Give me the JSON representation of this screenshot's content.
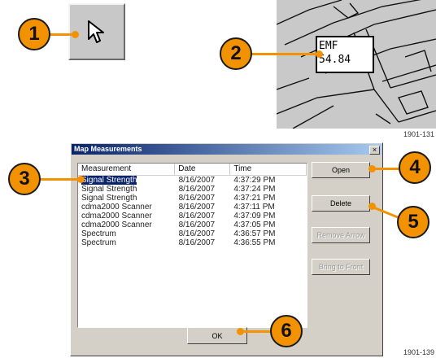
{
  "callouts": [
    "1",
    "2",
    "3",
    "4",
    "5",
    "6"
  ],
  "map": {
    "label": "EMF",
    "value": "54.84",
    "figure_id": "1901-131"
  },
  "dialog": {
    "title": "Map Measurements",
    "close_symbol": "×",
    "columns": [
      "Measurement",
      "Date",
      "Time"
    ],
    "rows": [
      {
        "measurement": "Signal Strength",
        "date": "8/16/2007",
        "time": "4:37:29 PM",
        "selected": true
      },
      {
        "measurement": "Signal Strength",
        "date": "8/16/2007",
        "time": "4:37:24 PM"
      },
      {
        "measurement": "Signal Strength",
        "date": "8/16/2007",
        "time": "4:37:21 PM"
      },
      {
        "measurement": "cdma2000 Scanner",
        "date": "8/16/2007",
        "time": "4:37:11 PM"
      },
      {
        "measurement": "cdma2000 Scanner",
        "date": "8/16/2007",
        "time": "4:37:09 PM"
      },
      {
        "measurement": "cdma2000 Scanner",
        "date": "8/16/2007",
        "time": "4:37:05 PM"
      },
      {
        "measurement": "Spectrum",
        "date": "8/16/2007",
        "time": "4:36:57 PM"
      },
      {
        "measurement": "Spectrum",
        "date": "8/16/2007",
        "time": "4:36:55 PM"
      }
    ],
    "buttons": {
      "open": "Open",
      "delete": "Delete",
      "remove_arrow": "Remove Arrow",
      "bring_to_front": "Bring to Front",
      "ok": "OK"
    }
  },
  "figure_id_bottom": "1901-139",
  "icons": {
    "pointer": "arrow-pointer-icon",
    "close": "close-icon"
  },
  "colors": {
    "callout": "#f39200",
    "titlebar_start": "#0a246a",
    "titlebar_end": "#a6caf0",
    "dialog_bg": "#d4d0c8",
    "selection": "#0a246a"
  }
}
